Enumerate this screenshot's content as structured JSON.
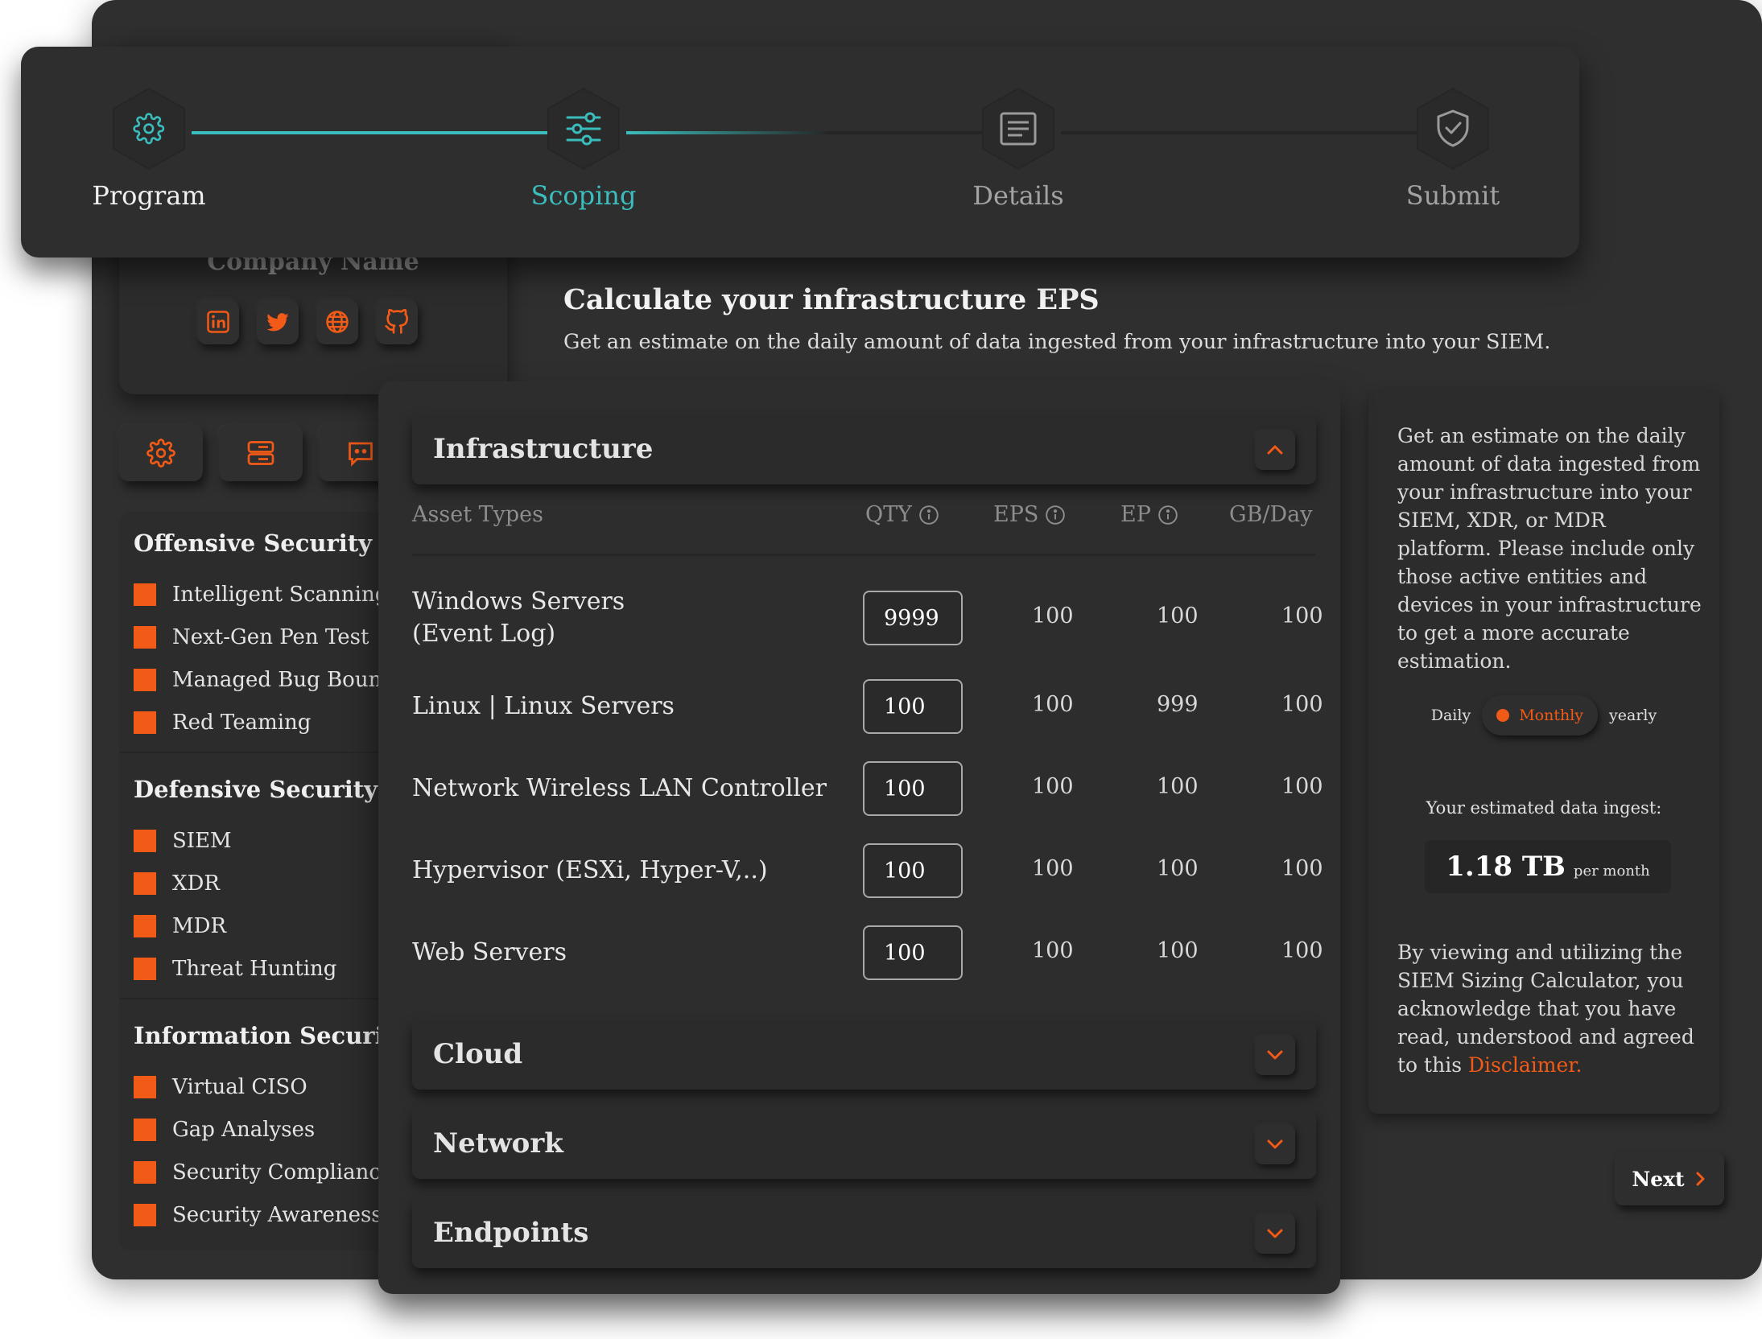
{
  "colors": {
    "accent": "#f25a17",
    "active": "#3bbdbd",
    "background": "#2f2f2f"
  },
  "sidebar": {
    "company_name": "Company Name",
    "socials": [
      {
        "icon": "linkedin-icon"
      },
      {
        "icon": "twitter-icon"
      },
      {
        "icon": "globe-icon"
      },
      {
        "icon": "github-icon"
      }
    ],
    "quick_icons": [
      "gear-icon",
      "server-icon",
      "chat-icon"
    ],
    "groups": [
      {
        "title": "Offensive Security",
        "items": [
          "Intelligent Scanning",
          "Next-Gen Pen Test",
          "Managed Bug Bounty",
          "Red Teaming"
        ]
      },
      {
        "title": "Defensive Security",
        "items": [
          "SIEM",
          "XDR",
          "MDR",
          "Threat Hunting"
        ]
      },
      {
        "title": "Information Security",
        "items": [
          "Virtual CISO",
          "Gap Analyses",
          "Security Compliance",
          "Security Awareness"
        ]
      }
    ]
  },
  "stepper": {
    "steps": [
      {
        "label": "Program",
        "icon": "gear-icon",
        "state": "completed"
      },
      {
        "label": "Scoping",
        "icon": "sliders-icon",
        "state": "active"
      },
      {
        "label": "Details",
        "icon": "document-icon",
        "state": "upcoming"
      },
      {
        "label": "Submit",
        "icon": "shield-check-icon",
        "state": "upcoming"
      }
    ]
  },
  "content": {
    "title": "Calculate your infrastructure EPS",
    "subtitle": "Get an estimate on the daily amount of data ingested from your infrastructure into your SIEM."
  },
  "infrastructure": {
    "title": "Infrastructure",
    "expanded": true,
    "columns": {
      "asset": "Asset Types",
      "qty": "QTY",
      "eps": "EPS",
      "ep": "EP",
      "gb": "GB/Day"
    },
    "rows": [
      {
        "label_line1": "Windows Servers",
        "label_line2": "(Event Log)",
        "qty": "9999",
        "eps": "100",
        "ep": "100",
        "gb": "100"
      },
      {
        "label_line1": "Linux | Linux Servers",
        "label_line2": "",
        "qty": "100",
        "eps": "100",
        "ep": "999",
        "gb": "100"
      },
      {
        "label_line1": "Network Wireless LAN Controller",
        "label_line2": "",
        "qty": "100",
        "eps": "100",
        "ep": "100",
        "gb": "100"
      },
      {
        "label_line1": "Hypervisor (ESXi, Hyper-V,..)",
        "label_line2": "",
        "qty": "100",
        "eps": "100",
        "ep": "100",
        "gb": "100"
      },
      {
        "label_line1": "Web Servers",
        "label_line2": "",
        "qty": "100",
        "eps": "100",
        "ep": "100",
        "gb": "100"
      }
    ]
  },
  "sections": [
    {
      "title": "Cloud",
      "expanded": false
    },
    {
      "title": "Network",
      "expanded": false
    },
    {
      "title": "Endpoints",
      "expanded": false
    }
  ],
  "info_panel": {
    "text": "Get an estimate on the daily amount of data ingested from your infrastructure into your SIEM, XDR, or MDR platform. Please include only those active entities and devices in your infrastructure to get a more accurate estimation.",
    "period": {
      "daily": "Daily",
      "monthly": "Monthly",
      "yearly": "yearly",
      "selected": "Monthly"
    },
    "ingest_label": "Your estimated data ingest:",
    "ingest_value": "1.18 TB",
    "ingest_unit": "per month",
    "disclaimer_text": "By viewing and utilizing the SIEM Sizing Calculator, you acknowledge that you have read, understood and agreed to this ",
    "disclaimer_link": "Disclaimer."
  },
  "next_label": "Next"
}
